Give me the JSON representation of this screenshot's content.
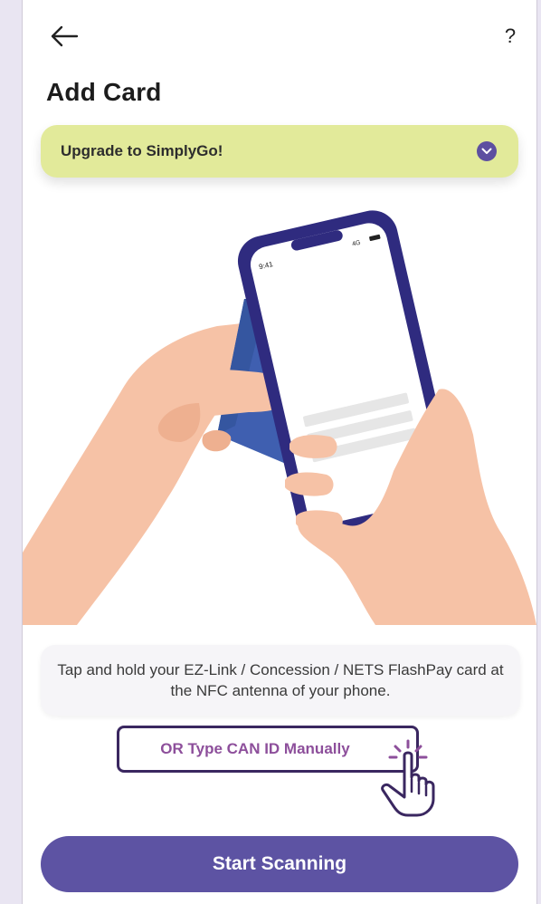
{
  "header": {
    "back_icon": "arrow-left-icon",
    "help_label": "?"
  },
  "page": {
    "title": "Add Card"
  },
  "upgrade_banner": {
    "label": "Upgrade to SimplyGo!",
    "icon": "chevron-down-icon"
  },
  "illustration": {
    "status_time": "9:41",
    "status_network": "4G"
  },
  "hint": {
    "text": "Tap and hold your EZ-Link / Concession / NETS FlashPay card at the NFC antenna of your phone."
  },
  "manual_entry": {
    "label": "OR Type CAN ID Manually"
  },
  "primary_action": {
    "label": "Start Scanning"
  },
  "colors": {
    "accent": "#5d53a3",
    "banner": "#e2ea9a",
    "link": "#8d4f9b",
    "phone_frame": "#2f2b7f",
    "card": "#3f5fb0",
    "skin": "#f6c2a6"
  }
}
